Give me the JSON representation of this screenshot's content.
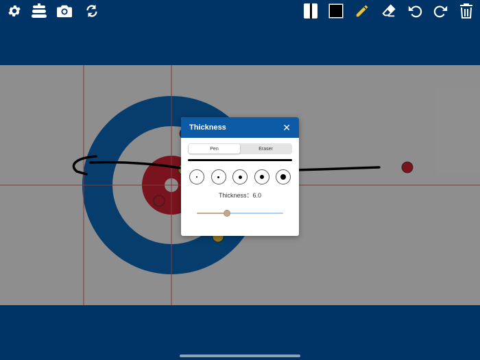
{
  "toolbar": {
    "left_icons": [
      "gear-icon",
      "curling-stones-icon",
      "camera-icon",
      "refresh-icon"
    ],
    "right_icons": [
      "line-style-icon",
      "color-swatch-icon",
      "pencil-icon",
      "eraser-icon",
      "undo-icon",
      "redo-icon",
      "trash-icon"
    ],
    "selected_color": "#000000",
    "pencil_color": "#e8c436"
  },
  "sheet": {
    "house_colors": {
      "outer": "#0b63b0",
      "inner": "#c41f2f",
      "background": "#e6e6e6",
      "lines": "#d95c5c"
    },
    "stones": [
      "red",
      "yellow",
      "yellow",
      "red",
      "red"
    ]
  },
  "dialog": {
    "title": "Thickness",
    "close_icon": "close-icon",
    "tabs": [
      "Pen",
      "Eraser"
    ],
    "active_tab": "Pen",
    "size_options": [
      1,
      2,
      3,
      4,
      5
    ],
    "thickness_label": "Thickness：6.0",
    "slider_value_fraction": 0.35,
    "slider_colors": {
      "filled": "#c3a88c",
      "rest": "#a9d0f0"
    }
  }
}
